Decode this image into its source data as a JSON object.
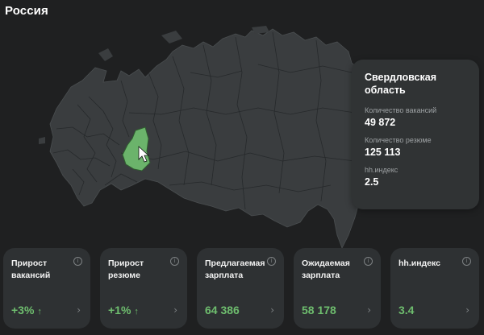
{
  "page": {
    "title": "Россия"
  },
  "map": {
    "fill": "#3a3d3f",
    "stroke": "#25282a",
    "highlight_fill": "#6bb36b",
    "highlight_stroke": "#2f5e2f"
  },
  "region_card": {
    "name": "Свердловская область",
    "stats": [
      {
        "label": "Количество вакансий",
        "value": "49 872"
      },
      {
        "label": "Количество резюме",
        "value": "125 113"
      },
      {
        "label": "hh.индекс",
        "value": "2.5"
      }
    ]
  },
  "kpis": [
    {
      "title": "Прирост вакансий",
      "value": "+3%",
      "trend": "↑",
      "info": "i",
      "arrow": "›"
    },
    {
      "title": "Прирост резюме",
      "value": "+1%",
      "trend": "↑",
      "info": "i",
      "arrow": "›"
    },
    {
      "title": "Предлагаемая зарплата",
      "value": "64 386",
      "trend": "",
      "info": "i",
      "arrow": "›"
    },
    {
      "title": "Ожидаемая зарплата",
      "value": "58 178",
      "trend": "",
      "info": "i",
      "arrow": "›"
    },
    {
      "title": "hh.индекс",
      "value": "3.4",
      "trend": "",
      "info": "i",
      "arrow": "›"
    }
  ],
  "colors": {
    "accent_green": "#6ebd6e",
    "card_bg": "#2e3133",
    "page_bg": "#1f2021"
  }
}
